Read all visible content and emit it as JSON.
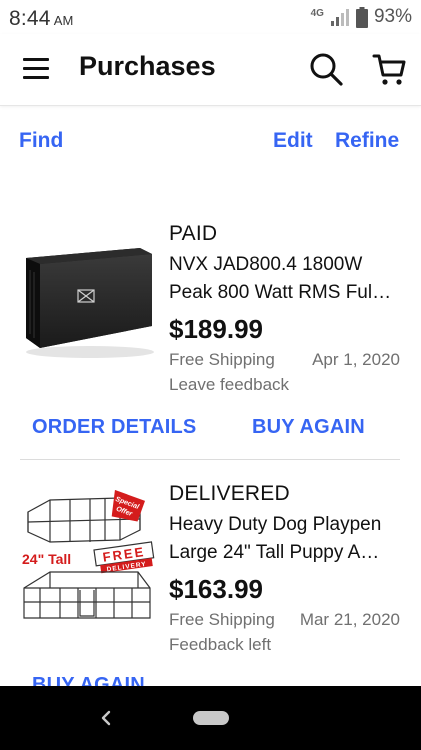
{
  "status_bar": {
    "time": "8:44",
    "ampm": "AM",
    "network": "4G",
    "battery": "93%"
  },
  "header": {
    "title": "Purchases",
    "icons": [
      "hamburger-menu-icon",
      "search-icon",
      "shopping-cart-icon"
    ]
  },
  "filters": {
    "find": "Find",
    "edit": "Edit",
    "refine": "Refine"
  },
  "orders": [
    {
      "status": "PAID",
      "title_line1": "NVX JAD800.4 1800W",
      "title_line2": "Peak 800 Watt RMS Ful…",
      "price": "$189.99",
      "shipping": "Free Shipping",
      "date": "Apr 1, 2020",
      "feedback": "Leave feedback",
      "order_details_label": "ORDER DETAILS",
      "buy_again_label": "BUY AGAIN",
      "image": "amplifier-photo"
    },
    {
      "status": "DELIVERED",
      "title_line1": "Heavy Duty Dog Playpen",
      "title_line2": "Large 24\" Tall Puppy A…",
      "price": "$163.99",
      "shipping": "Free Shipping",
      "date": "Mar 21, 2020",
      "feedback": "Feedback left",
      "buy_again_label": "BUY AGAIN",
      "image": "dog-playpen-photo",
      "image_text": {
        "tall": "24\" Tall",
        "free": "FREE",
        "delivery": "DELIVERY",
        "special": "Special",
        "offer": "Offer"
      }
    }
  ],
  "colors": {
    "link_blue": "#3665f3",
    "text_gray": "#707070",
    "nav_bar": "#000000"
  }
}
